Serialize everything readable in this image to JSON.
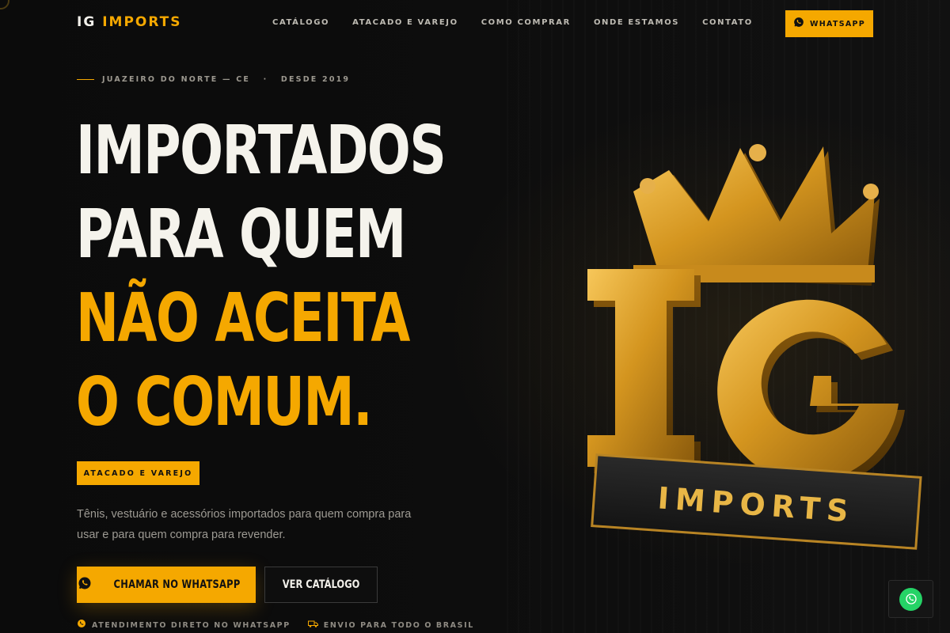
{
  "brand": {
    "name_part1": "IG",
    "name_part2": "IMPORTS"
  },
  "nav": {
    "items": [
      "CATÁLOGO",
      "ATACADO E VAREJO",
      "COMO COMPRAR",
      "ONDE ESTAMOS",
      "CONTATO"
    ],
    "whatsapp_label": "WHATSAPP"
  },
  "hero": {
    "kicker": "JUAZEIRO DO NORTE — CE   ·   DESDE 2019",
    "headline": [
      "IMPORTADOS",
      "PARA QUEM",
      "NÃO ACEITA",
      "O COMUM."
    ],
    "tag": "ATACADO E VAREJO",
    "description": "Tênis, vestuário e acessórios importados para quem compra para usar e para quem compra para revender.",
    "primary_cta": "CHAMAR NO WHATSAPP",
    "secondary_cta": "VER CATÁLOGO",
    "features": [
      "ATENDIMENTO DIRETO NO WHATSAPP",
      "ENVIO PARA TODO O BRASIL"
    ]
  },
  "emblem": {
    "letters": "IG",
    "plaque": "IMPORTS"
  },
  "colors": {
    "accent": "#f5a800",
    "background": "#0a0a0a",
    "whatsapp_green": "#25d366"
  }
}
